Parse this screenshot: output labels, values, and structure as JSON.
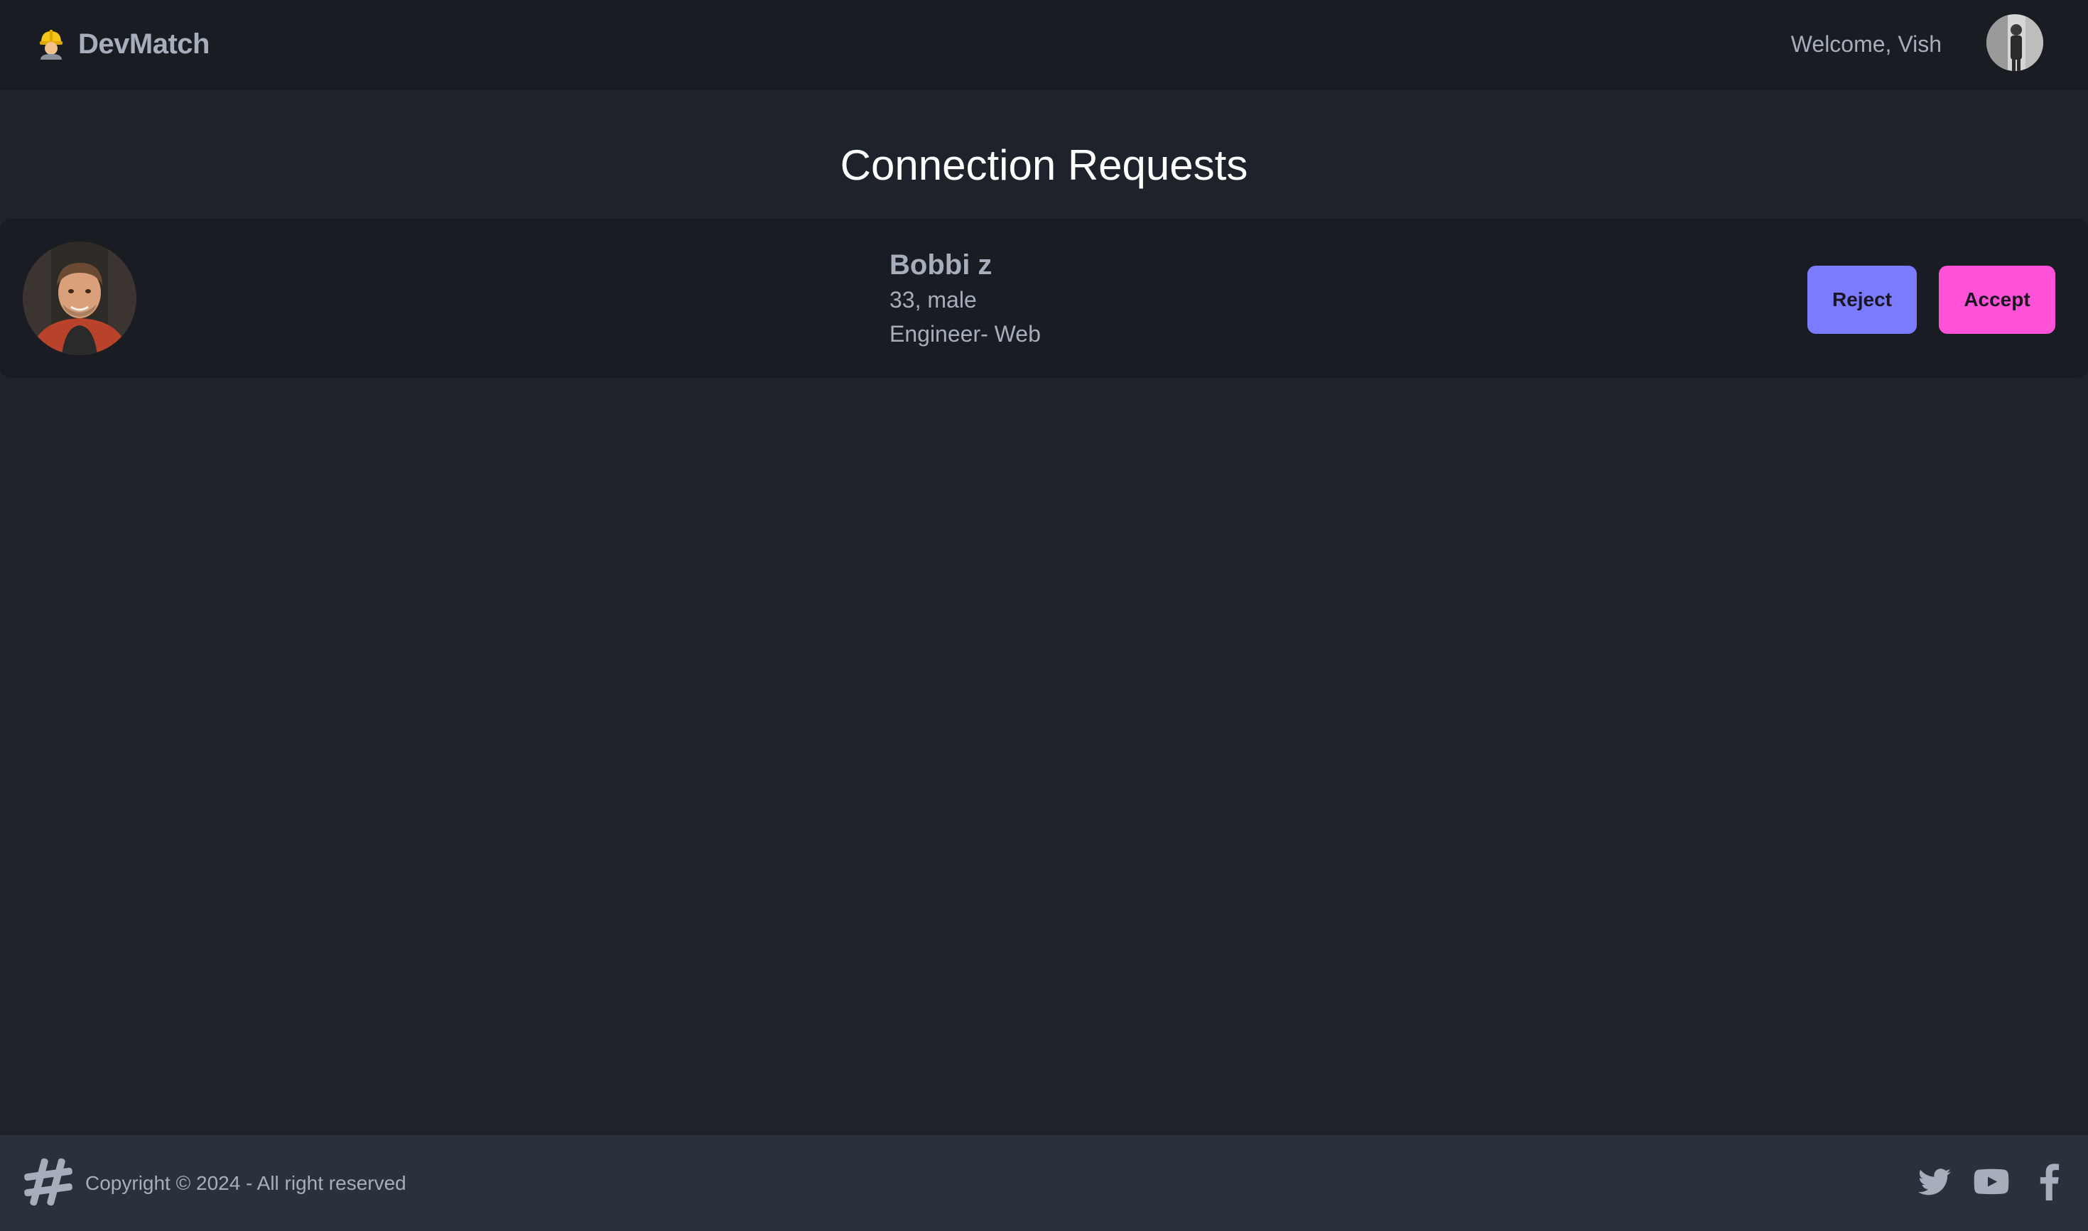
{
  "navbar": {
    "brand_emoji": "construction-worker-icon",
    "brand_name": "DevMatch",
    "welcome_text": "Welcome, Vish",
    "user_avatar": "user-avatar-photo"
  },
  "page": {
    "title": "Connection Requests"
  },
  "requests": [
    {
      "name": "Bobbi z",
      "age_gender": "33, male",
      "about": "Engineer- Web",
      "photo": "profile-photo",
      "reject_label": "Reject",
      "accept_label": "Accept"
    }
  ],
  "footer": {
    "copyright": "Copyright © 2024 - All right reserved",
    "logo": "hash-icon",
    "social": [
      "twitter-icon",
      "youtube-icon",
      "facebook-icon"
    ]
  },
  "colors": {
    "background": "#1e222b",
    "navbar": "#191d23",
    "footer": "#2a303c",
    "reject_button": "#7b7bff",
    "accept_button": "#ff52d9"
  }
}
